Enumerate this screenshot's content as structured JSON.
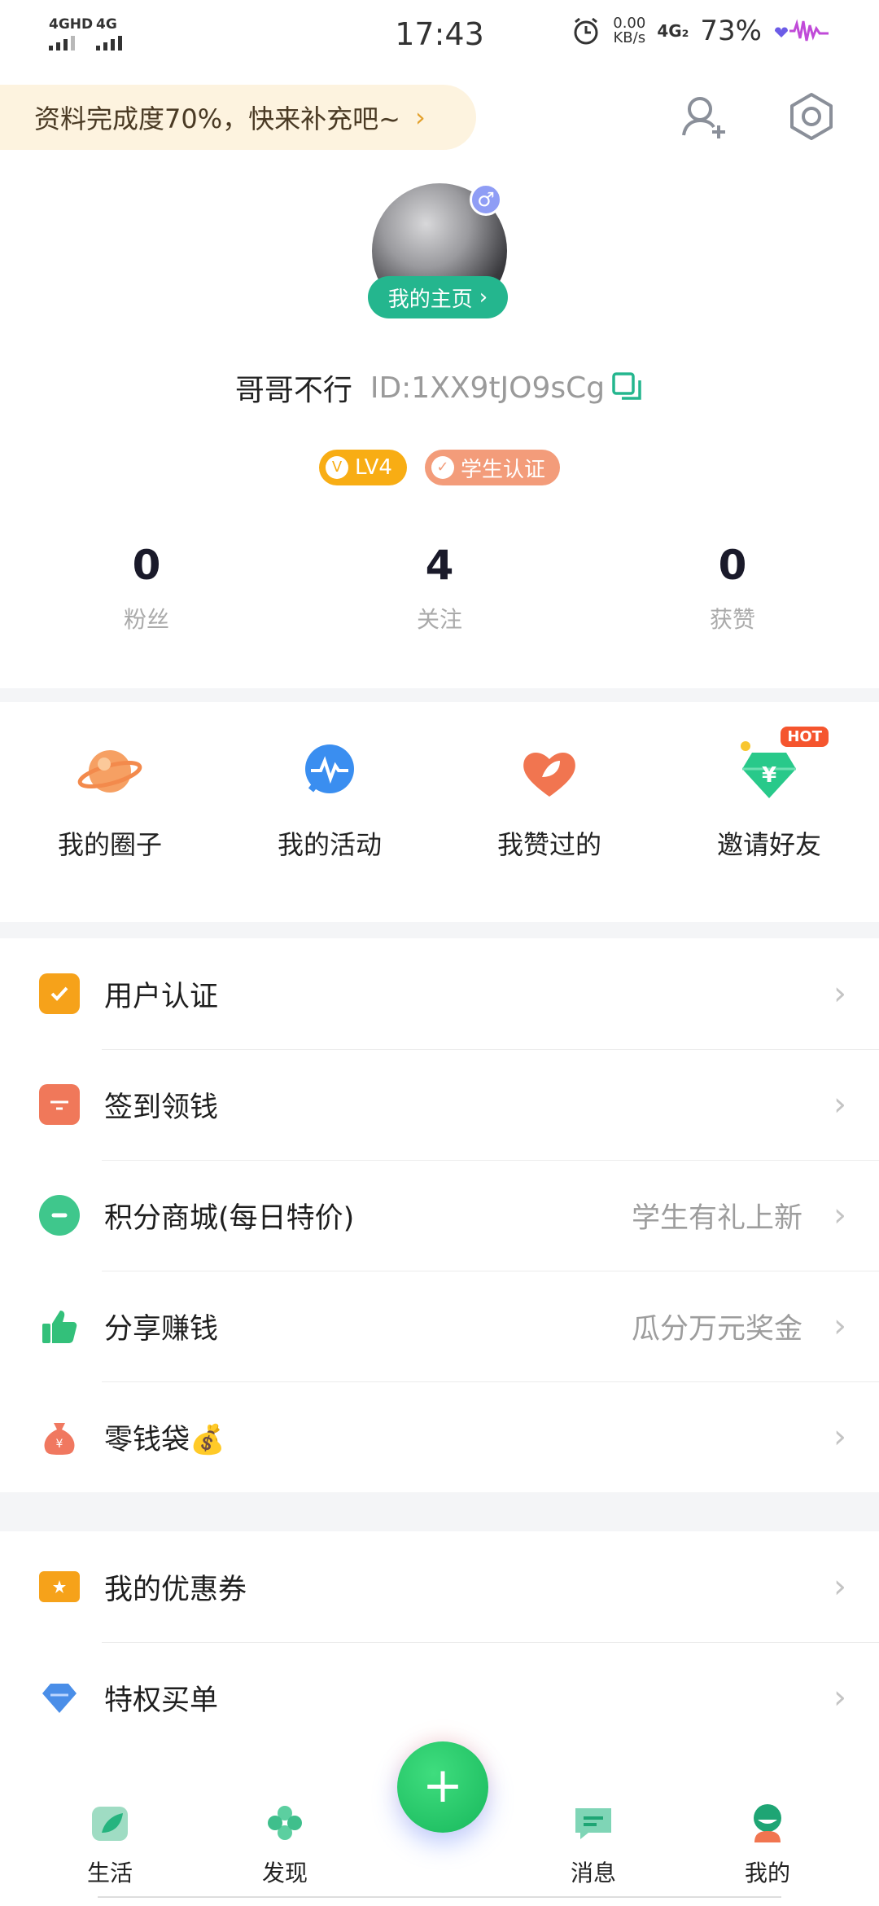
{
  "status_bar": {
    "net1": "4GHD",
    "net2": "4G",
    "time": "17:43",
    "speed_value": "0.00",
    "speed_unit": "KB/s",
    "net3": "4G₂",
    "battery": "73%"
  },
  "banner": {
    "text": "资料完成度70%，快来补充吧~",
    "chevron": "›"
  },
  "header_icons": [
    "add-friend-icon",
    "settings-icon"
  ],
  "profile": {
    "gender_symbol": "♂",
    "homepage_label": "我的主页",
    "homepage_chevron": "›",
    "name": "哥哥不行",
    "id": "ID:1XX9tJO9sCg",
    "level": "LV4",
    "level_mark": "V",
    "student_badge": "学生认证",
    "student_mark": "✓"
  },
  "stats": [
    {
      "value": "0",
      "label": "粉丝"
    },
    {
      "value": "4",
      "label": "关注"
    },
    {
      "value": "0",
      "label": "获赞"
    }
  ],
  "quick_actions": [
    {
      "label": "我的圈子",
      "icon": "planet-icon"
    },
    {
      "label": "我的活动",
      "icon": "activity-pulse-icon"
    },
    {
      "label": "我赞过的",
      "icon": "heart-leaf-icon"
    },
    {
      "label": "邀请好友",
      "icon": "yuan-diamond-icon",
      "hot": "HOT"
    }
  ],
  "menu_group_1": [
    {
      "label": "用户认证",
      "right": "",
      "icon": "verify-check-icon",
      "color": "#f6a21a"
    },
    {
      "label": "签到领钱",
      "right": "",
      "icon": "calendar-icon",
      "color": "#f0785a"
    },
    {
      "label": "积分商城(每日特价)",
      "right": "学生有礼上新",
      "icon": "points-coin-icon",
      "color": "#3fc78c"
    },
    {
      "label": "分享赚钱",
      "right": "瓜分万元奖金",
      "icon": "thumbs-up-icon",
      "color": "#33c07a"
    },
    {
      "label": "零钱袋💰",
      "right": "",
      "icon": "money-bag-icon",
      "color": "#f07860"
    }
  ],
  "menu_group_2": [
    {
      "label": "我的优惠券",
      "right": "",
      "icon": "coupon-icon",
      "color": "#f6a21a"
    },
    {
      "label": "特权买单",
      "right": "",
      "icon": "diamond-icon",
      "color": "#4a8ee8"
    }
  ],
  "row_chevron": "›",
  "bottom_nav": [
    {
      "label": "生活",
      "icon": "life-leaf-icon"
    },
    {
      "label": "发现",
      "icon": "discover-clover-icon"
    },
    {
      "label": "消息",
      "icon": "message-icon"
    },
    {
      "label": "我的",
      "icon": "me-avatar-icon"
    }
  ],
  "fab_symbol": "+"
}
